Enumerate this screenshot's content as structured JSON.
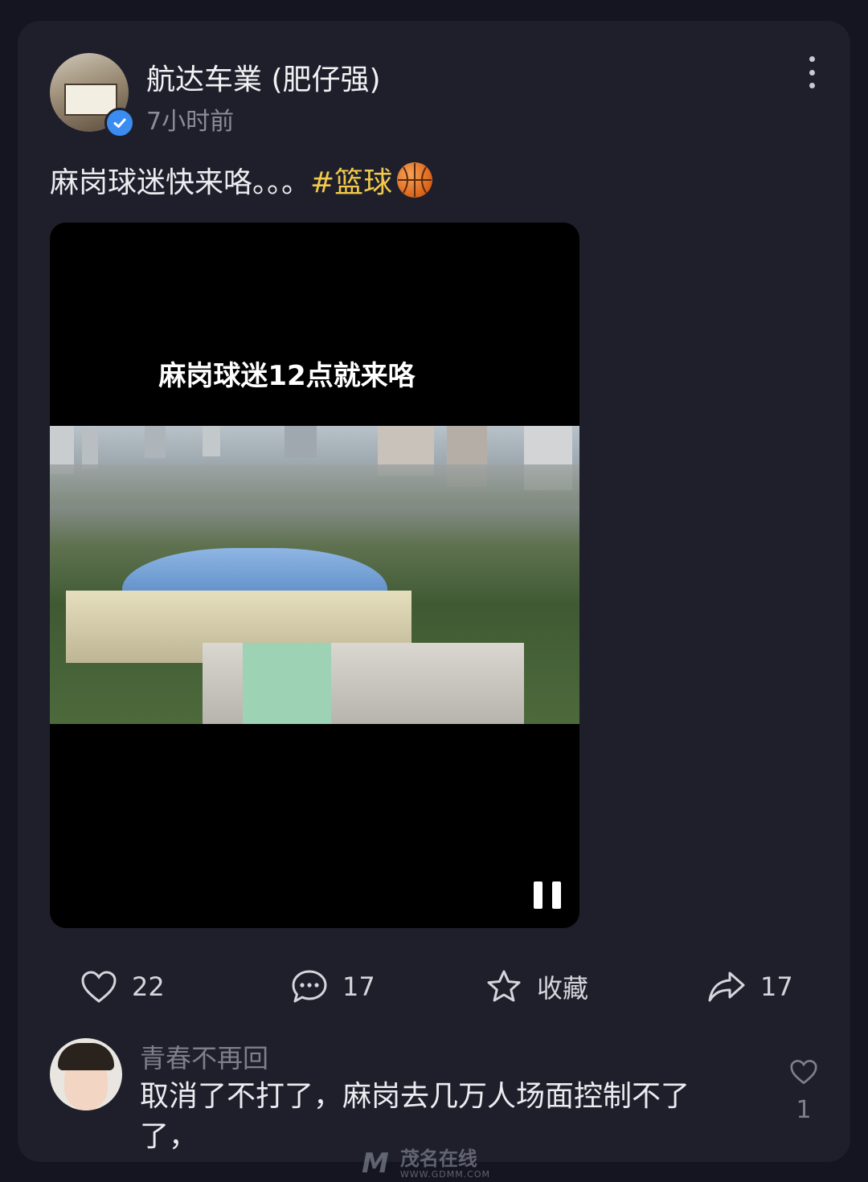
{
  "post": {
    "author": "航达车業 (肥仔强)",
    "time": "7小时前",
    "text": "麻岗球迷快来咯。。。",
    "hashtag": "#篮球",
    "video_caption": "麻岗球迷12点就来咯"
  },
  "actions": {
    "like_count": "22",
    "comment_count": "17",
    "favorite_label": "收藏",
    "share_count": "17"
  },
  "comment": {
    "author": "青春不再回",
    "text": "取消了不打了，麻岗去几万人场面控制不了了，",
    "like_count": "1"
  },
  "watermark": {
    "logo": "M",
    "name": "茂名在线",
    "url": "WWW.GDMM.COM"
  },
  "colors": {
    "background": "#141520",
    "card": "#1e1f2b",
    "hashtag": "#f2c94c",
    "verified": "#3a8cf0"
  }
}
